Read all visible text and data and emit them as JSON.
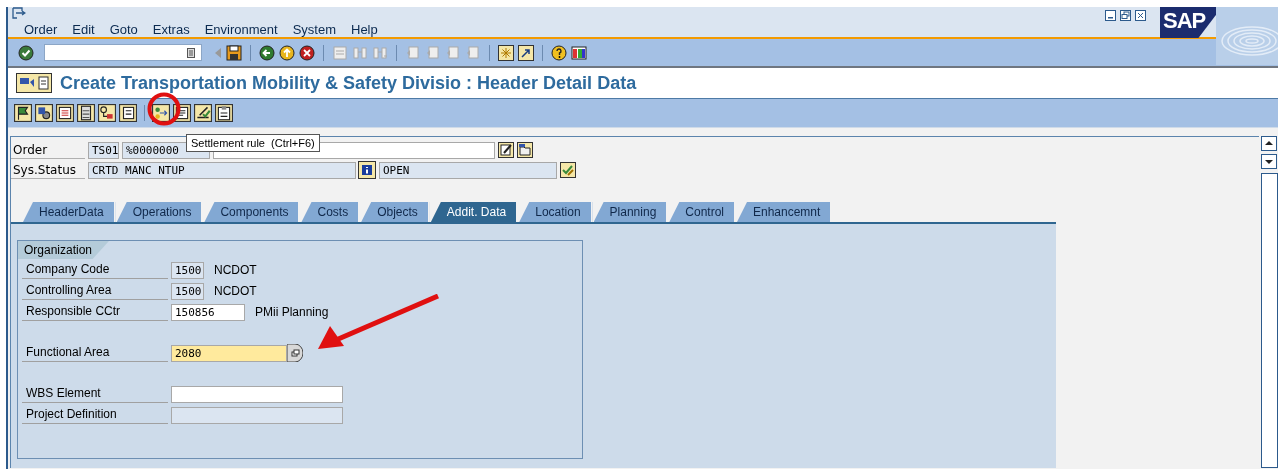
{
  "menu": [
    {
      "label": "Order"
    },
    {
      "label": "Edit"
    },
    {
      "label": "Goto"
    },
    {
      "label": "Extras"
    },
    {
      "label": "Environment"
    },
    {
      "label": "System"
    },
    {
      "label": "Help"
    }
  ],
  "logo": "SAP",
  "title": "Create Transportation Mobility & Safety Divisio : Header Detail Data",
  "tooltip": "Settlement rule  (Ctrl+F6)",
  "order": {
    "label": "Order",
    "type": "TS01",
    "number": "%0000000"
  },
  "sys_status": {
    "label": "Sys.Status",
    "status": "CRTD MANC NTUP",
    "user_status": "OPEN"
  },
  "tabs": [
    {
      "label": "HeaderData",
      "selected": false
    },
    {
      "label": "Operations",
      "selected": false
    },
    {
      "label": "Components",
      "selected": false
    },
    {
      "label": "Costs",
      "selected": false
    },
    {
      "label": "Objects",
      "selected": false
    },
    {
      "label": "Addit. Data",
      "selected": true
    },
    {
      "label": "Location",
      "selected": false
    },
    {
      "label": "Planning",
      "selected": false
    },
    {
      "label": "Control",
      "selected": false
    },
    {
      "label": "Enhancemnt",
      "selected": false
    }
  ],
  "group": {
    "title": "Organization",
    "fields": [
      {
        "label": "Company Code",
        "kind": "display",
        "value": "1500",
        "description": "NCDOT"
      },
      {
        "label": "Controlling Area",
        "kind": "display",
        "value": "1500",
        "description": "NCDOT"
      },
      {
        "label": "Responsible CCtr",
        "kind": "input",
        "value": "150856",
        "description": "PMii Planning"
      },
      {
        "label": "Functional Area",
        "kind": "focused",
        "value": "2080",
        "gap_before": true
      },
      {
        "label": "WBS Element",
        "kind": "input",
        "gap_before": true
      },
      {
        "label": "Project Definition",
        "kind": "display"
      }
    ]
  }
}
